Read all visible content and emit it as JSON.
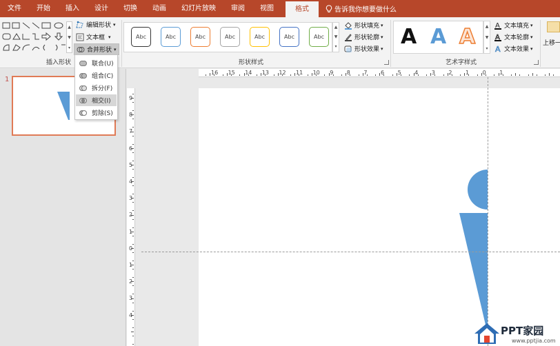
{
  "tabs": [
    "文件",
    "开始",
    "插入",
    "设计",
    "切换",
    "动画",
    "幻灯片放映",
    "审阅",
    "视图",
    "格式"
  ],
  "active_tab": "格式",
  "tell_me": "告诉我你想要做什么",
  "ribbon": {
    "insert_shapes": {
      "label": "插入形状",
      "edit_shape": "编辑形状",
      "text_box": "文本框",
      "merge_shapes": "合并形状"
    },
    "shape_styles": {
      "label": "形状样式",
      "preset_text": "Abc",
      "presets": [
        {
          "border": "#333333"
        },
        {
          "border": "#5b9bd5"
        },
        {
          "border": "#ed7d31"
        },
        {
          "border": "#a5a5a5"
        },
        {
          "border": "#ffc000"
        },
        {
          "border": "#4472c4"
        },
        {
          "border": "#70ad47"
        }
      ],
      "fill": "形状填充",
      "outline": "形状轮廓",
      "effects": "形状效果"
    },
    "wordart_styles": {
      "label": "艺术字样式",
      "glyph": "A",
      "text_fill": "文本填充",
      "text_outline": "文本轮廓",
      "text_effects": "文本效果"
    },
    "arrange": {
      "bring_forward": "上移一"
    }
  },
  "merge_menu": {
    "items": [
      {
        "label": "联合(U)",
        "name": "union"
      },
      {
        "label": "组合(C)",
        "name": "combine"
      },
      {
        "label": "拆分(F)",
        "name": "fragment"
      },
      {
        "label": "相交(I)",
        "name": "intersect",
        "highlighted": true
      },
      {
        "label": "剪除(S)",
        "name": "subtract"
      }
    ]
  },
  "slide_panel": {
    "slide_number": "1"
  },
  "rulers": {
    "horizontal": [
      "16",
      "15",
      "14",
      "13",
      "12",
      "11",
      "10",
      "9",
      "8",
      "7",
      "6",
      "5",
      "4",
      "3",
      "2",
      "1",
      "0",
      "1"
    ],
    "vertical": [
      "9",
      "8",
      "7",
      "6",
      "5",
      "4",
      "3",
      "2",
      "1",
      "0",
      "1",
      "2",
      "3",
      "4"
    ]
  },
  "shape_color": "#5b9bd5",
  "accent_color": "#b7472a",
  "watermark": {
    "title": "PPT家园",
    "url": "www.pptjia.com"
  }
}
